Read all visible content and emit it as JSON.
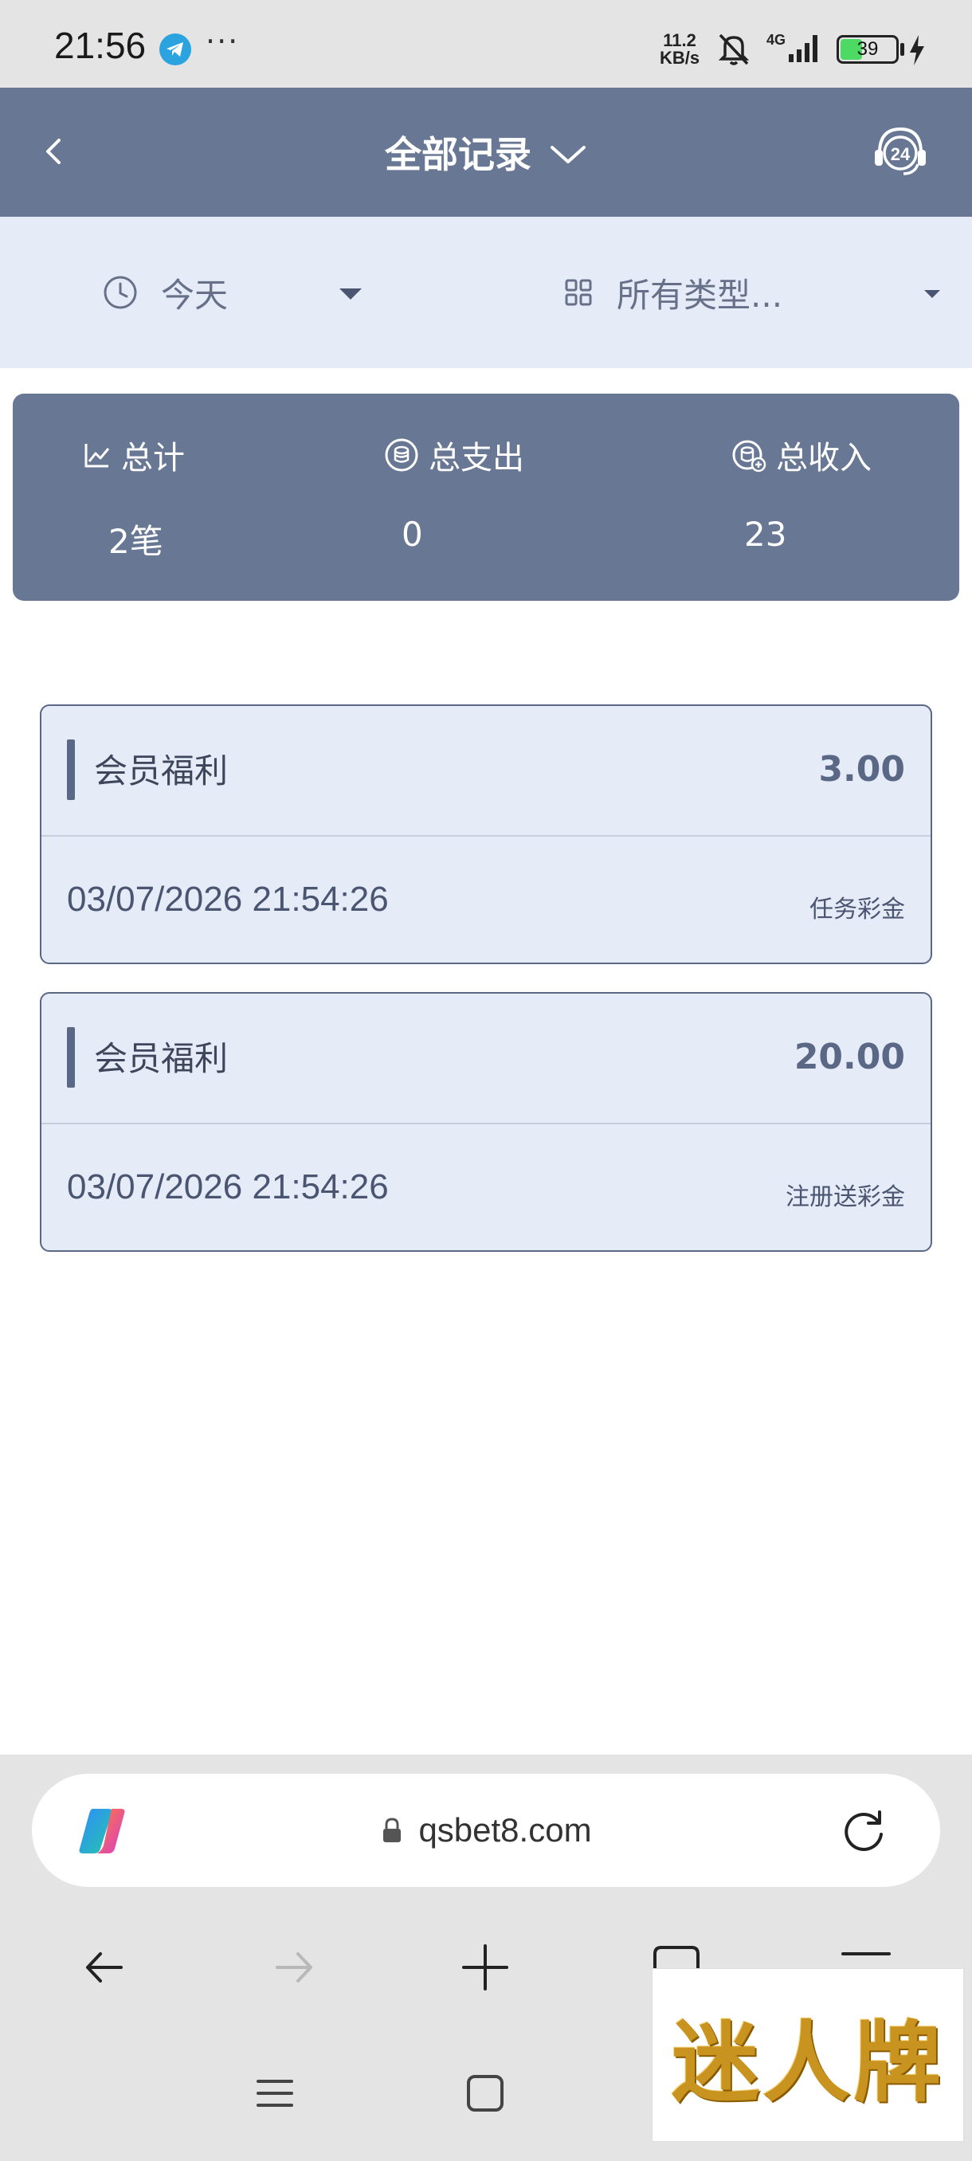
{
  "status_bar": {
    "time": "21:56",
    "dots": "···",
    "net_speed_value": "11.2",
    "net_speed_unit": "KB/s",
    "network": "4G",
    "battery_level": "39",
    "icons": [
      "telegram-icon",
      "bell-muted-icon",
      "signal-icon",
      "battery-icon",
      "charging-icon"
    ]
  },
  "header": {
    "title": "全部记录",
    "icons": [
      "back-icon",
      "chevron-down-icon",
      "support-24-icon"
    ],
    "support_label": "24"
  },
  "filters": {
    "date_label": "今天",
    "type_label": "所有类型..."
  },
  "summary": {
    "total_label": "总计",
    "total_value": "2笔",
    "expense_label": "总支出",
    "expense_value": "0",
    "income_label": "总收入",
    "income_value": "23"
  },
  "records": [
    {
      "title": "会员福利",
      "amount": "3.00",
      "time": "03/07/2026 21:54:26",
      "type": "任务彩金"
    },
    {
      "title": "会员福利",
      "amount": "20.00",
      "time": "03/07/2026 21:54:26",
      "type": "注册送彩金"
    }
  ],
  "browser": {
    "url": "qsbet8.com",
    "icons": [
      "copilot-icon",
      "lock-icon",
      "reload-icon",
      "back-arrow-icon",
      "forward-arrow-icon",
      "new-tab-icon",
      "tabs-icon",
      "menu-icon"
    ]
  },
  "watermark": {
    "text": "迷人牌"
  },
  "colors": {
    "header_bg": "#677794",
    "filter_bg": "#e5ecf7",
    "card_border": "#5a6886"
  }
}
